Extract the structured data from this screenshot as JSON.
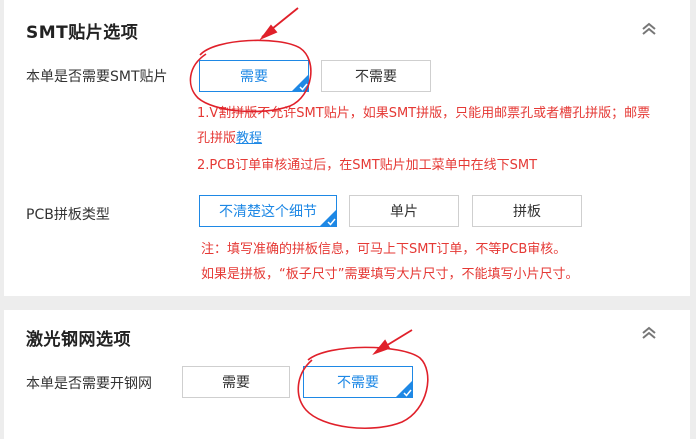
{
  "smt": {
    "title": "SMT贴片选项",
    "need_label": "本单是否需要SMT贴片",
    "need_options": [
      "需要",
      "不需要"
    ],
    "need_selected": "需要",
    "note1_line1": "1.V割拼版不允许SMT贴片，如果SMT拼版，只能用邮票孔或者槽孔拼版；邮票",
    "note1_line2_prefix": "孔拼版",
    "note1_link": "教程",
    "note2": "2.PCB订单审核通过后，在SMT贴片加工菜单中在线下SMT",
    "panel_label": "PCB拼板类型",
    "panel_options": [
      "不清楚这个细节",
      "单片",
      "拼板"
    ],
    "panel_selected": "不清楚这个细节",
    "panel_note1": "注：填写准确的拼板信息，可马上下SMT订单，不等PCB审核。",
    "panel_note2": "如果是拼板，“板子尺寸”需要填写大片尺寸，不能填写小片尺寸。"
  },
  "stencil": {
    "title": "激光钢网选项",
    "need_label": "本单是否需要开钢网",
    "need_options": [
      "需要",
      "不需要"
    ],
    "need_selected": "不需要"
  },
  "icons": {
    "collapse": "double-chevron-up-icon",
    "selected_check": "corner-check-icon",
    "annotation_arrow": "red-arrow-annotation",
    "annotation_circle": "red-circle-annotation"
  },
  "colors": {
    "accent": "#1e88e5",
    "warning_text": "#e53935",
    "annotation": "#e0202a",
    "page_bg": "#ededed"
  }
}
